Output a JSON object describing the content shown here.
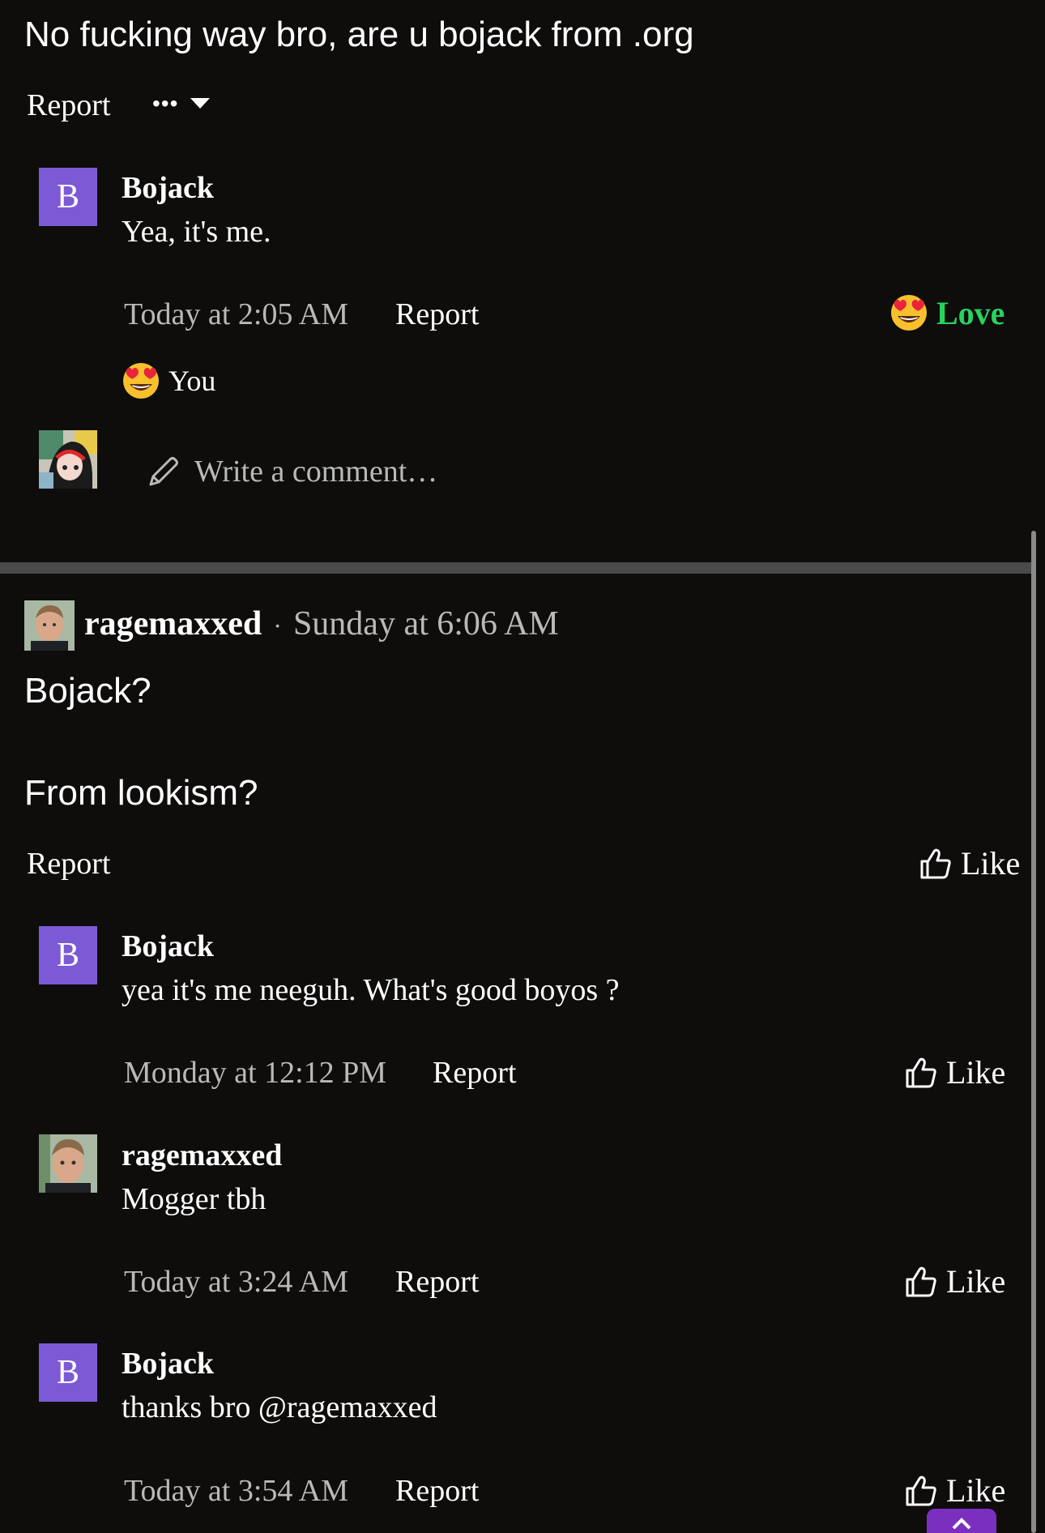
{
  "top_post": {
    "text": "No fucking way bro, are u bojack from .org",
    "report_label": "Report",
    "more_label": "•••"
  },
  "reply1": {
    "avatar_letter": "B",
    "author": "Bojack",
    "message": "Yea, it's me.",
    "time": "Today at 2:05 AM",
    "report_label": "Report",
    "reaction_label": "Love",
    "reactor": "You"
  },
  "write_comment": {
    "placeholder": "Write a comment…"
  },
  "post2": {
    "author": "ragemaxxed",
    "separator": "·",
    "time": "Sunday at 6:06 AM",
    "line1": "Bojack?",
    "line2": "From lookism?",
    "report_label": "Report",
    "like_label": "Like"
  },
  "comments": [
    {
      "avatar_letter": "B",
      "author": "Bojack",
      "message": "yea it's me neeguh. What's good boyos ?",
      "time": "Monday at 12:12 PM",
      "report_label": "Report",
      "like_label": "Like"
    },
    {
      "author": "ragemaxxed",
      "message": "Mogger tbh",
      "time": "Today at 3:24 AM",
      "report_label": "Report",
      "like_label": "Like"
    },
    {
      "avatar_letter": "B",
      "author": "Bojack",
      "message": "thanks bro @ragemaxxed",
      "time": "Today at 3:54 AM",
      "report_label": "Report",
      "like_label": "Like"
    }
  ],
  "colors": {
    "background": "#0f0c0c",
    "avatar_purple": "#7c5ad6",
    "love_green": "#27d35c",
    "meta_gray": "#b9b9b9",
    "scroll_top_button": "#7b2fbe"
  }
}
